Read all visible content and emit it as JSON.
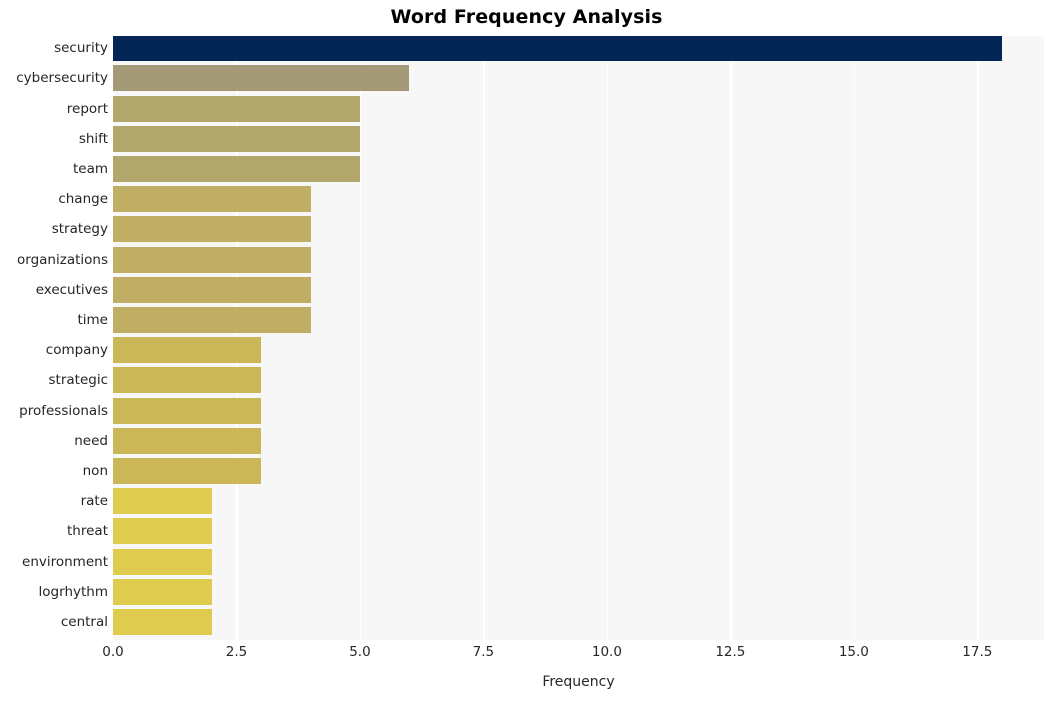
{
  "chart_data": {
    "type": "bar",
    "orientation": "horizontal",
    "title": "Word Frequency Analysis",
    "xlabel": "Frequency",
    "ylabel": "",
    "categories": [
      "security",
      "cybersecurity",
      "report",
      "shift",
      "team",
      "change",
      "strategy",
      "organizations",
      "executives",
      "time",
      "company",
      "strategic",
      "professionals",
      "need",
      "non",
      "rate",
      "threat",
      "environment",
      "logrhythm",
      "central"
    ],
    "values": [
      18,
      6,
      5,
      5,
      5,
      4,
      4,
      4,
      4,
      4,
      3,
      3,
      3,
      3,
      3,
      2,
      2,
      2,
      2,
      2
    ],
    "bar_colors": [
      "#042656",
      "#a49a77",
      "#b1a66c",
      "#b1a66c",
      "#b1a66c",
      "#bfae63",
      "#bfae63",
      "#bfae63",
      "#bfae63",
      "#bfae63",
      "#cbb757",
      "#cbb757",
      "#cbb757",
      "#cbb757",
      "#cbb757",
      "#dfcb4e",
      "#dfcb4e",
      "#dfcb4e",
      "#dfcb4e",
      "#dfcb4e"
    ],
    "xticks": [
      "0.0",
      "2.5",
      "5.0",
      "7.5",
      "10.0",
      "12.5",
      "15.0",
      "17.5"
    ],
    "xtick_values": [
      0,
      2.5,
      5,
      7.5,
      10,
      12.5,
      15,
      17.5
    ],
    "xlim": [
      0,
      18.85
    ],
    "grid": true,
    "grid_axis": "x",
    "grid_color": "#ffffff",
    "plot_background": "#f7f7f7",
    "figure_background": "#ffffff",
    "legend": null
  }
}
